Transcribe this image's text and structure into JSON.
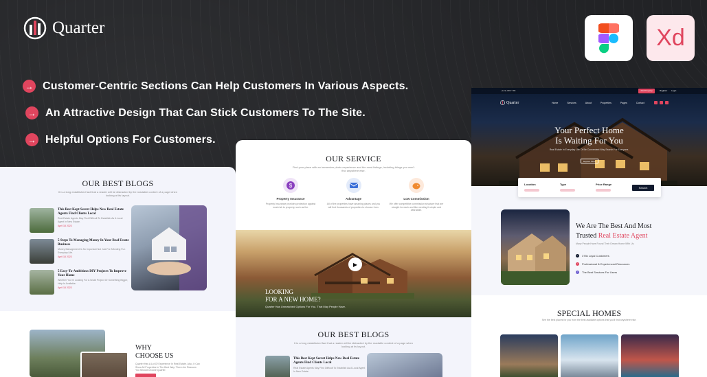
{
  "brand": {
    "name": "Quarter"
  },
  "features": [
    "Customer-Centric Sections Can Help Customers In Various Aspects.",
    "An Attractive Design That Can Stick Customers To The Site.",
    "Helpful Options For Customers."
  ],
  "tools": {
    "figma": "figma-icon",
    "xd": "Xd"
  },
  "colors": {
    "accent": "#e0455e",
    "dark": "#222326",
    "navy": "#111a2e"
  },
  "left_panel": {
    "title": "OUR BEST BLOGS",
    "subtitle": "It is a long established fact that a reader will be distracted by the readable content of a page when looking at its layout.",
    "blogs": [
      {
        "title": "This Best Kept Secret Helps New Real Estate Agents Find Clients Local",
        "text": "Real Estate Agents May Find Difficult To Establish As A Local Agent In New Estate.",
        "date": "April 18 2023"
      },
      {
        "title": "5 Steps To Managing Money In Your Real Estate Business",
        "text": "Money Management Is So Important Not Just For Affording Fun Everyday Life.",
        "date": "April 18 2023"
      },
      {
        "title": "5 Easy-To-Ambitious DIY Projects To Improve Your Home",
        "text": "Whether You're Looking For A Small Project Or Something Bigger, Help Is Available.",
        "date": "April 18 2023"
      }
    ],
    "why": {
      "title_line1": "WHY",
      "title_line2": "CHOOSE US",
      "text": "Quarter Has A Lot Of Experience In Real Estate. Also, It Can Show All Properties In The Best Way. There Are Reasons You Should Choose Quarter."
    }
  },
  "mid_panel": {
    "service_title": "OUR SERVICE",
    "service_subtitle": "Find your place with an immersive photo experience and the most listings, including things you won't find anywhere else.",
    "services": [
      {
        "title": "Property Insurance",
        "text": "Property Insurance provides protection against most risk to property, such as fire."
      },
      {
        "title": "Advantage",
        "text": "All of the properties have amazing places and you will find thousands of properties to choose from."
      },
      {
        "title": "Low Commission",
        "text": "We offer competitive commission structure that are straight for each and like meeting it simple and affordable."
      }
    ],
    "video": {
      "line1": "LOOKING",
      "line2": "FOR A NEW HOME?",
      "sub": "Quarter Has Unmatched Options For You. That May People Have."
    },
    "blogs_title": "OUR BEST BLOGS",
    "blogs_subtitle": "It is a long established fact that a reader will be distracted by the readable content of a page when looking at its layout.",
    "blog": {
      "title": "This Best Kept Secret Helps New Real Estate Agents Find Clients Local",
      "text": "Real Estate Agents May Find Difficult To Establish As A Local Agent In New Estate."
    }
  },
  "right_panel": {
    "topbar_text": "(123) 4567 789",
    "topbar_button": "Add Property",
    "topbar_links": [
      "Register",
      "Login"
    ],
    "nav_brand": "Quarter",
    "nav_items": [
      "Home",
      "Services",
      "About",
      "Properties",
      "Pages",
      "Contact"
    ],
    "hero_line1": "Your Perfect Home",
    "hero_line2": "Is Waiting For You",
    "hero_sub": "Real Estate In Everyday Life Of Be Convenient Way Search For Everyone.",
    "hero_button": "Explore More",
    "search": {
      "location": "Location",
      "type": "Type",
      "price": "Price Range",
      "button": "Search"
    },
    "best_line1": "We Are The Best And Most",
    "best_line2a": "Trusted ",
    "best_line2b": "Real Estate Agent",
    "best_sub": "Many People Have Found Their Dream Home With Us.",
    "checks": [
      "375k Loyal Customers",
      "Professional & Experienced Resources",
      "The Best Services For Users"
    ],
    "special_title": "SPECIAL HOMES",
    "special_sub": "See the best places for you from the best available options that you'll find anywhere else."
  }
}
